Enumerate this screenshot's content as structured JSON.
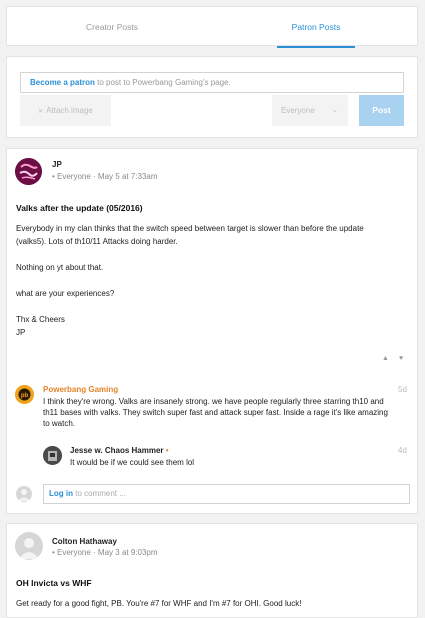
{
  "tabs": [
    {
      "label": "Creator Posts",
      "active": false
    },
    {
      "label": "Patron Posts",
      "active": true
    }
  ],
  "composer": {
    "become_patron": "Become a patron",
    "prompt_rest": "to post to Powerbang Gaming's page.",
    "attach_label": "Attach image",
    "audience_label": "Everyone",
    "post_label": "Post"
  },
  "post1": {
    "author": "JP",
    "meta": "• Everyone · May 5 at 7:33am",
    "title": "Valks after the update (05/2016)",
    "lines": [
      "Everybody in my clan thinks that the switch speed between target is slower than before the update",
      "(valks5). Lots of th10/11 Attacks doing harder.",
      "Nothing on yt about that.",
      "what are your experiences?",
      "Thx & Cheers",
      "JP"
    ],
    "comments": [
      {
        "author": "Powerbang Gaming",
        "time": "5d",
        "text": "I think they're wrong. Valks are insanely strong. we have people regularly three starring th10 and th11 bases with valks. They switch super fast and attack super fast. Inside a rage it's like amazing to watch.",
        "actions": "· ·"
      },
      {
        "author": "Jesse w. Chaos Hammer",
        "badge": "•",
        "time": "4d",
        "text": "It would be if we could see them lol",
        "actions": "· ·"
      }
    ],
    "comment_login": "Log in",
    "comment_placeholder": "to comment ..."
  },
  "post2": {
    "author": "Colton Hathaway",
    "meta": "• Everyone · May 3 at 9:03pm",
    "title": "OH Invicta vs WHF",
    "line": "Get ready for a good fight, PB. You're #7 for WHF and I'm #7 for OHI. Good luck!"
  },
  "colors": {
    "accent": "#2a8fd6",
    "post_button": "#a9d1f0",
    "creator_name": "#e4832a"
  }
}
